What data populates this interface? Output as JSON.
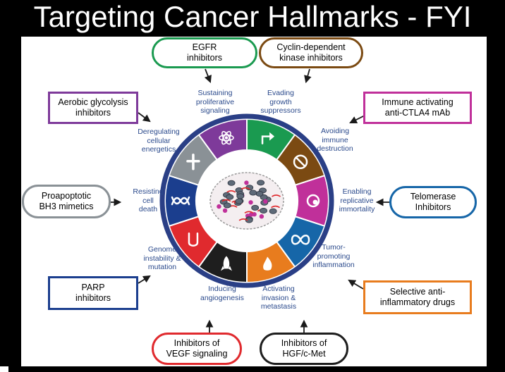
{
  "title": "Targeting Cancer Hallmarks - FYI",
  "hallmarks": [
    {
      "key": "proliferative",
      "lines": [
        "Sustaining",
        "proliferative",
        "signaling"
      ],
      "color": "#1a9a50",
      "icon": "arrow-icon"
    },
    {
      "key": "growth",
      "lines": [
        "Evading",
        "growth",
        "suppressors"
      ],
      "color": "#7b4a12",
      "icon": "prohibition-icon"
    },
    {
      "key": "immune",
      "lines": [
        "Avoiding",
        "immune",
        "destruction"
      ],
      "color": "#c0309a",
      "icon": "immune-cell-icon"
    },
    {
      "key": "immortality",
      "lines": [
        "Enabling",
        "replicative",
        "immortality"
      ],
      "color": "#1666a8",
      "icon": "infinity-icon"
    },
    {
      "key": "inflammation",
      "lines": [
        "Tumor-",
        "promoting",
        "inflammation"
      ],
      "color": "#e87c1e",
      "icon": "flame-icon"
    },
    {
      "key": "metastasis",
      "lines": [
        "Activating",
        "invasion &",
        "metastasis"
      ],
      "color": "#1e1e1e",
      "icon": "rocket-icon"
    },
    {
      "key": "angiogenesis",
      "lines": [
        "Inducing",
        "angiogenesis"
      ],
      "color": "#e02a2e",
      "icon": "vessel-icon"
    },
    {
      "key": "genome",
      "lines": [
        "Genome",
        "instability &",
        "mutation"
      ],
      "color": "#1b3e8e",
      "icon": "dna-icon"
    },
    {
      "key": "death",
      "lines": [
        "Resisting",
        "cell",
        "death"
      ],
      "color": "#8a9196",
      "icon": "cross-icon"
    },
    {
      "key": "energetics",
      "lines": [
        "Deregulating",
        "cellular",
        "energetics"
      ],
      "color": "#7e3a9a",
      "icon": "atom-icon"
    }
  ],
  "drugs": [
    {
      "key": "egfr",
      "lines": [
        "EGFR",
        "inhibitors"
      ],
      "color": "#1a9a50",
      "shape": "pill"
    },
    {
      "key": "cdk",
      "lines": [
        "Cyclin-dependent",
        "kinase inhibitors"
      ],
      "color": "#7b4a12",
      "shape": "pill"
    },
    {
      "key": "ctla4",
      "lines": [
        "Immune activating",
        "anti-CTLA4 mAb"
      ],
      "color": "#c0309a",
      "shape": "rect"
    },
    {
      "key": "telomerase",
      "lines": [
        "Telomerase",
        "Inhibitors"
      ],
      "color": "#1666a8",
      "shape": "pill"
    },
    {
      "key": "antiinflam",
      "lines": [
        "Selective anti-",
        "inflammatory drugs"
      ],
      "color": "#e87c1e",
      "shape": "rect"
    },
    {
      "key": "hgf",
      "lines": [
        "Inhibitors of",
        "HGF/c-Met"
      ],
      "color": "#1e1e1e",
      "shape": "pill"
    },
    {
      "key": "vegf",
      "lines": [
        "Inhibitors of",
        "VEGF signaling"
      ],
      "color": "#e02a2e",
      "shape": "pill"
    },
    {
      "key": "parp",
      "lines": [
        "PARP",
        "inhibitors"
      ],
      "color": "#1b3e8e",
      "shape": "rect"
    },
    {
      "key": "bh3",
      "lines": [
        "Proapoptotic",
        "BH3 mimetics"
      ],
      "color": "#8a9196",
      "shape": "pill"
    },
    {
      "key": "glycolysis",
      "lines": [
        "Aerobic glycolysis",
        "inhibitors"
      ],
      "color": "#7e3a9a",
      "shape": "rect"
    }
  ],
  "colors": {
    "ring_border": "#2a3f86",
    "label_text": "#2b4a8c"
  }
}
